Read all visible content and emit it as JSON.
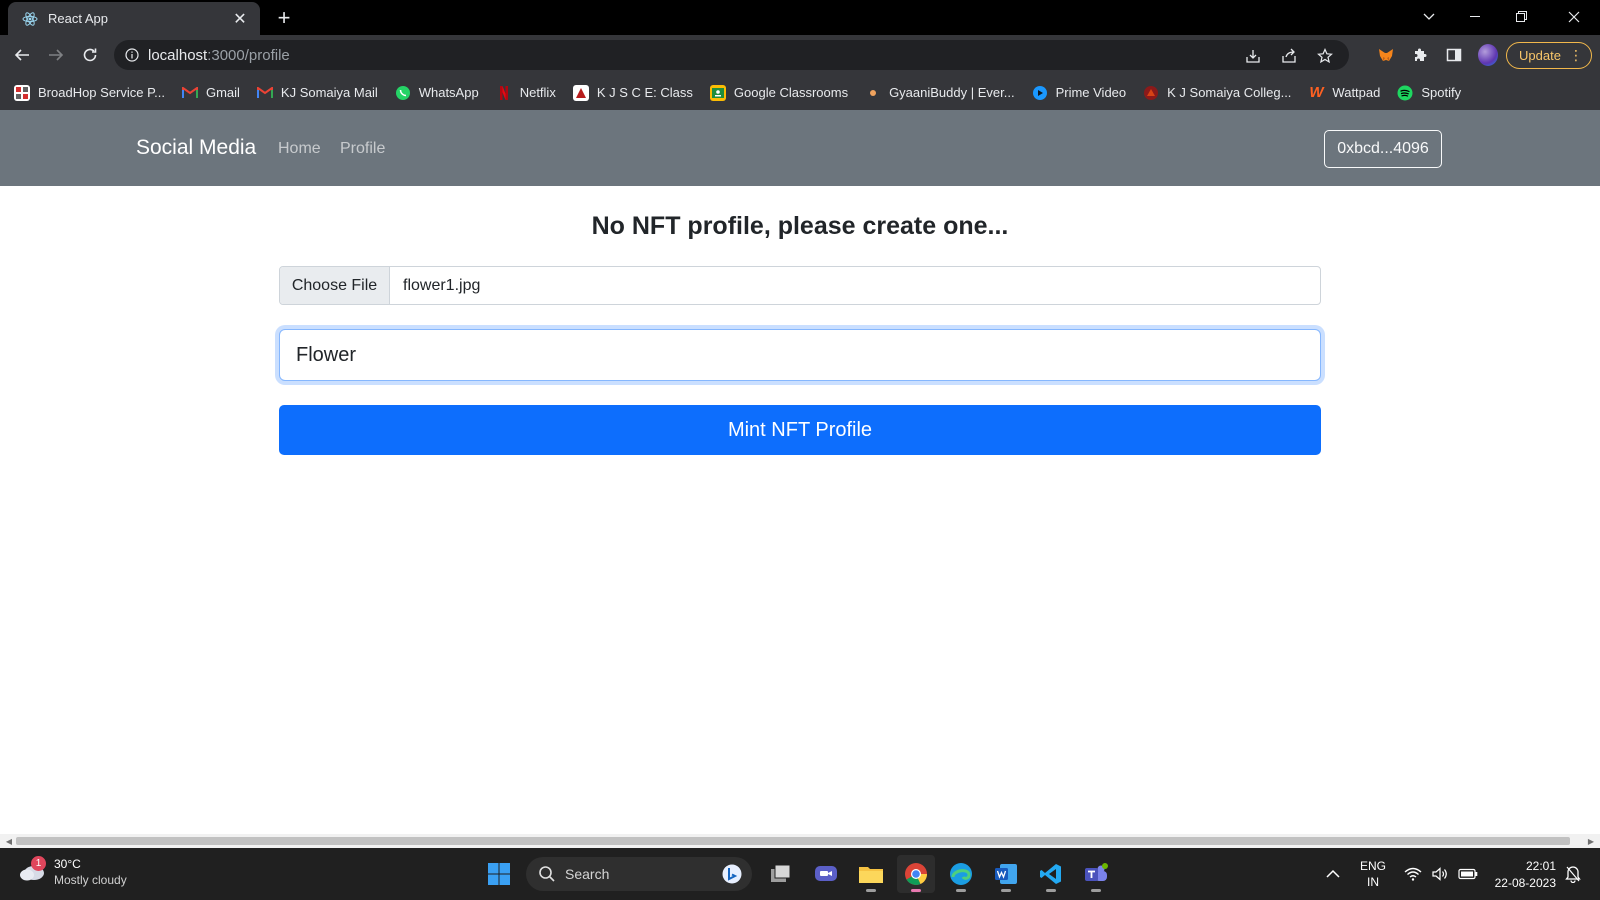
{
  "browser": {
    "tab_title": "React App",
    "url_host": "localhost",
    "url_path": ":3000/profile",
    "update_label": "Update",
    "bookmarks": [
      {
        "label": "BroadHop Service P...",
        "icon": "broadhop-icon"
      },
      {
        "label": "Gmail",
        "icon": "gmail-icon"
      },
      {
        "label": "KJ Somaiya Mail",
        "icon": "gmail-icon"
      },
      {
        "label": "WhatsApp",
        "icon": "whatsapp-icon"
      },
      {
        "label": "Netflix",
        "icon": "netflix-icon"
      },
      {
        "label": "K J S C E: Class",
        "icon": "kjsce-icon"
      },
      {
        "label": "Google Classrooms",
        "icon": "classroom-icon"
      },
      {
        "label": "GyaaniBuddy | Ever...",
        "icon": "gyaanibuddy-icon"
      },
      {
        "label": "Prime Video",
        "icon": "prime-video-icon"
      },
      {
        "label": "K J Somaiya Colleg...",
        "icon": "somaiya-icon"
      },
      {
        "label": "Wattpad",
        "icon": "wattpad-icon"
      },
      {
        "label": "Spotify",
        "icon": "spotify-icon"
      }
    ]
  },
  "navbar": {
    "brand": "Social Media",
    "links": [
      "Home",
      "Profile"
    ],
    "account": "0xbcd...4096"
  },
  "main": {
    "headline": "No NFT profile, please create one...",
    "file_button": "Choose File",
    "file_name": "flower1.jpg",
    "username_value": "Flower",
    "mint_button": "Mint NFT Profile"
  },
  "taskbar": {
    "weather_temp": "30°C",
    "weather_desc": "Mostly cloudy",
    "weather_badge": "1",
    "search_label": "Search",
    "lang_line1": "ENG",
    "lang_line2": "IN",
    "time": "22:01",
    "date": "22-08-2023"
  },
  "colors": {
    "navbar_bg": "#6c757d",
    "primary": "#0d6efd",
    "chrome_dark": "#35363a"
  }
}
